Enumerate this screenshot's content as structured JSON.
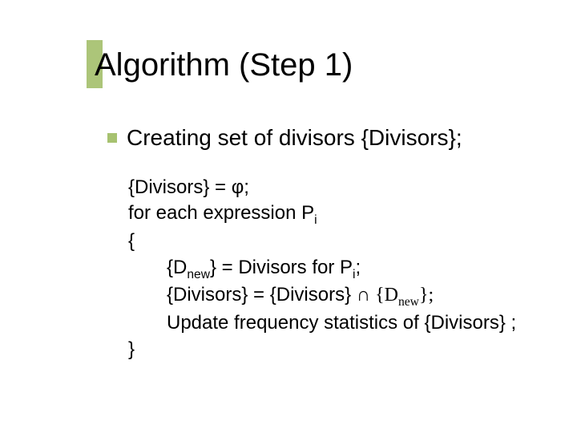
{
  "title": "Algorithm (Step 1)",
  "bullet": "Creating set of divisors {Divisors};",
  "code": {
    "l1_a": "{Divisors} = ",
    "l1_phi": "φ",
    "l1_b": ";",
    "l2_a": "for each expression P",
    "l2_sub": "i",
    "l3": "{",
    "l4_a": "{D",
    "l4_sub1": "new",
    "l4_b": "} = Divisors for P",
    "l4_sub2": "i",
    "l4_c": ";",
    "l5_a": "{Divisors} = {Divisors} ",
    "l5_serif_a": "∩ {D",
    "l5_serif_sub": "new",
    "l5_serif_b": "};",
    "l6": "Update frequency statistics of {Divisors} ;",
    "l7": "}"
  }
}
